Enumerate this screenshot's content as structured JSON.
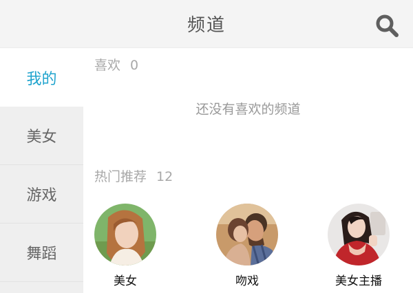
{
  "header": {
    "title": "频道",
    "search_icon": "search-icon"
  },
  "colors": {
    "accent": "#1ea3cd",
    "sidebar_bg": "#efefef",
    "header_bg": "#f4f4f4"
  },
  "sidebar": {
    "items": [
      {
        "label": "我的",
        "active": true
      },
      {
        "label": "美女",
        "active": false
      },
      {
        "label": "游戏",
        "active": false
      },
      {
        "label": "舞蹈",
        "active": false
      }
    ]
  },
  "favorites": {
    "label": "喜欢",
    "count": "0",
    "empty_text": "还没有喜欢的频道"
  },
  "hot": {
    "label": "热门推荐",
    "count": "12",
    "channels": [
      {
        "label": "美女"
      },
      {
        "label": "吻戏"
      },
      {
        "label": "美女主播"
      }
    ]
  }
}
